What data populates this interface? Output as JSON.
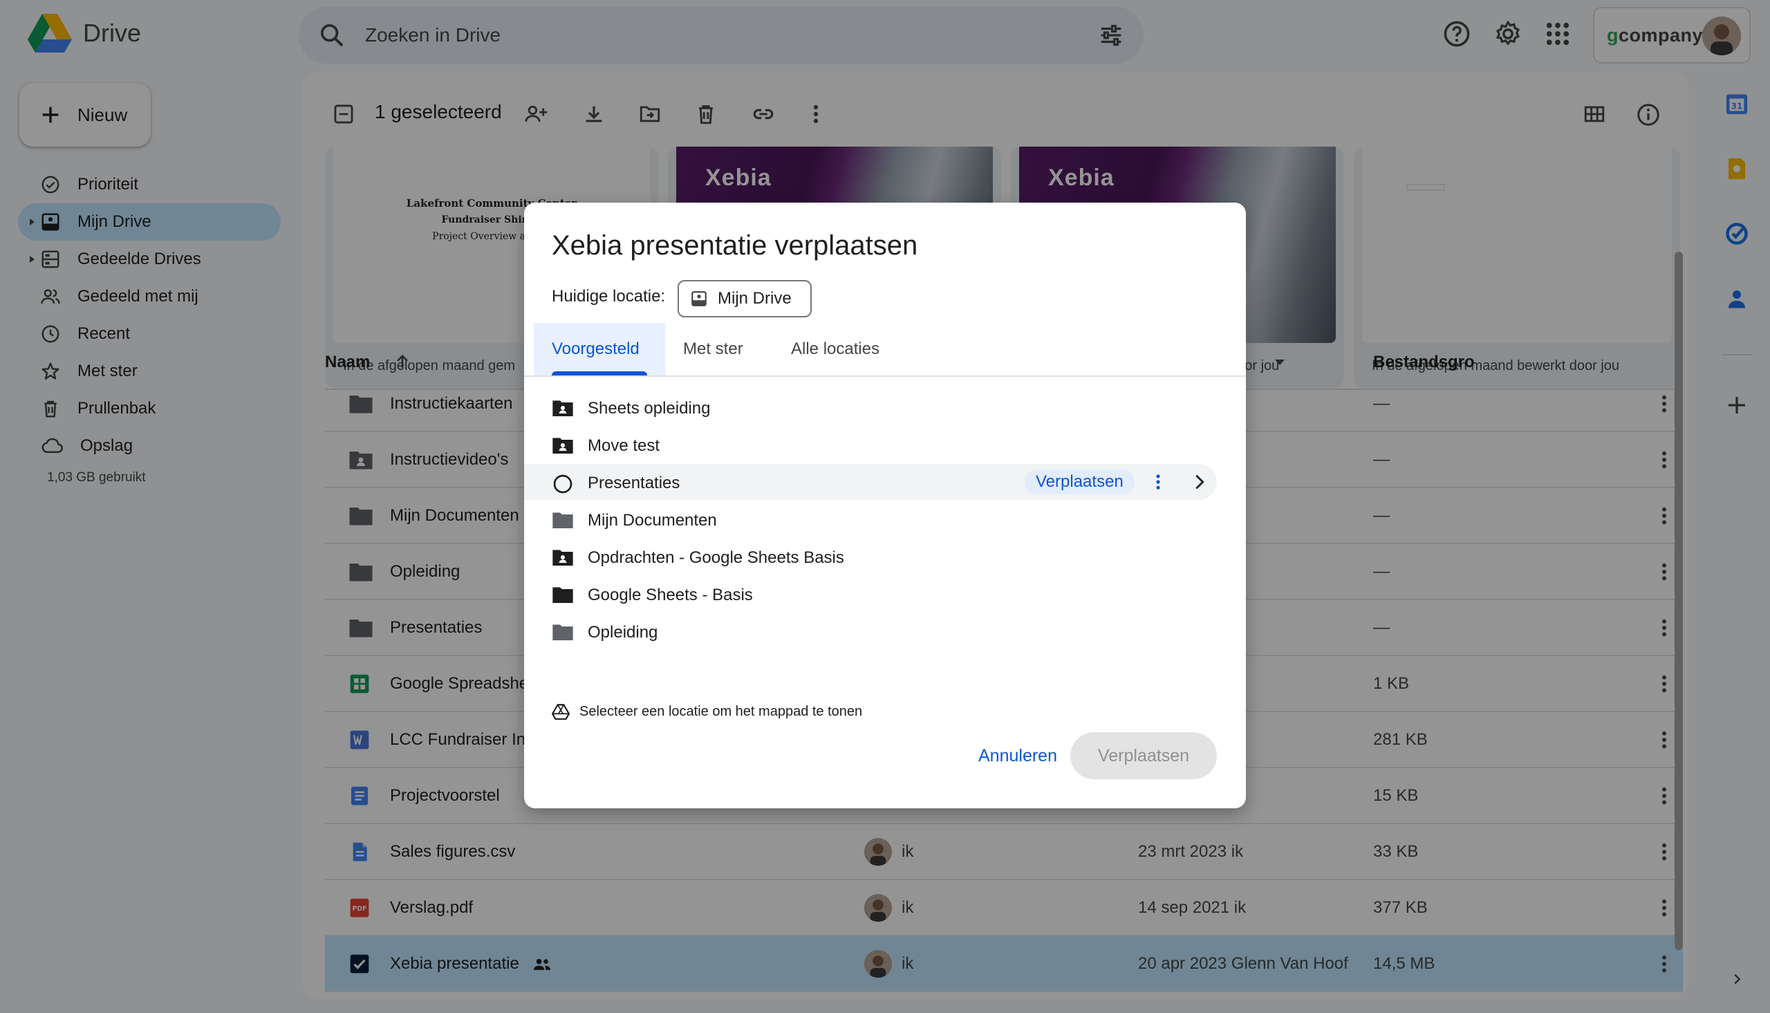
{
  "app": {
    "title": "Drive"
  },
  "search": {
    "placeholder": "Zoeken in Drive"
  },
  "account": {
    "brand_g": "g",
    "brand_rest": "company"
  },
  "sidebar": {
    "new_label": "Nieuw",
    "items": [
      {
        "label": "Prioriteit",
        "icon": "priority-icon"
      },
      {
        "label": "Mijn Drive",
        "icon": "my-drive-icon",
        "active": true
      },
      {
        "label": "Gedeelde Drives",
        "icon": "shared-drives-icon"
      },
      {
        "label": "Gedeeld met mij",
        "icon": "shared-with-me-icon"
      },
      {
        "label": "Recent",
        "icon": "clock-icon"
      },
      {
        "label": "Met ster",
        "icon": "star-icon"
      },
      {
        "label": "Prullenbak",
        "icon": "trash-icon"
      },
      {
        "label": "Opslag",
        "icon": "cloud-icon"
      }
    ],
    "storage_used": "1,03 GB gebruikt"
  },
  "toolbar": {
    "selected_count": "1 geselecteerd"
  },
  "cards": [
    {
      "caption": "In de afgelopen maand gem",
      "thumb_lines": [
        "Lakefront Community Center",
        "Fundraiser Shirt S",
        "Project Overview and M"
      ]
    },
    {
      "caption": "",
      "logo": "Xebia"
    },
    {
      "caption": "door jou",
      "logo": "Xebia"
    },
    {
      "caption": "In de afgelopen maand bewerkt door jou"
    }
  ],
  "table": {
    "headers": {
      "name": "Naam",
      "size": "Bestandsgro"
    },
    "rows": [
      {
        "name": "Instructiekaarten",
        "type": "folder",
        "owner": "",
        "date": "",
        "size": "—"
      },
      {
        "name": "Instructievideo's",
        "type": "shared-folder",
        "owner": "",
        "date": "",
        "size": "—"
      },
      {
        "name": "Mijn Documenten",
        "type": "folder",
        "owner": "",
        "date": "",
        "size": "—"
      },
      {
        "name": "Opleiding",
        "type": "folder",
        "owner": "",
        "date": "",
        "size": "—"
      },
      {
        "name": "Presentaties",
        "type": "folder",
        "owner": "",
        "date": "",
        "size": "—"
      },
      {
        "name": "Google Spreadshe",
        "type": "sheets",
        "owner": "",
        "date": "",
        "size": "1 KB"
      },
      {
        "name": "LCC Fundraiser In",
        "type": "word",
        "owner": "",
        "date": "",
        "size": "281 KB"
      },
      {
        "name": "Projectvoorstel",
        "type": "docs",
        "owner": "",
        "date": "",
        "size": "15 KB"
      },
      {
        "name": "Sales figures.csv",
        "type": "csv",
        "owner": "ik",
        "date": "23 mrt 2023",
        "date_by": "ik",
        "size": "33 KB"
      },
      {
        "name": "Verslag.pdf",
        "type": "pdf",
        "owner": "ik",
        "date": "14 sep 2021",
        "date_by": "ik",
        "size": "377 KB"
      },
      {
        "name": "Xebia presentatie",
        "type": "selected",
        "owner": "ik",
        "date": "20 apr 2023",
        "date_by": "Glenn Van Hoof",
        "size": "14,5 MB"
      }
    ]
  },
  "dialog": {
    "title": "Xebia presentatie verplaatsen",
    "current_location_label": "Huidige locatie:",
    "current_location": "Mijn Drive",
    "tabs": [
      "Voorgesteld",
      "Met ster",
      "Alle locaties"
    ],
    "folders": [
      {
        "name": "Sheets opleiding",
        "icon": "shared-folder-icon"
      },
      {
        "name": "Move test",
        "icon": "shared-folder-icon"
      },
      {
        "name": "Presentaties",
        "icon": "radio-icon",
        "hover": true
      },
      {
        "name": "Mijn Documenten",
        "icon": "folder-icon"
      },
      {
        "name": "Opdrachten - Google Sheets Basis",
        "icon": "shared-folder-icon"
      },
      {
        "name": "Google Sheets - Basis",
        "icon": "folder-black-icon"
      },
      {
        "name": "Opleiding",
        "icon": "folder-icon"
      }
    ],
    "row_move_label": "Verplaatsen",
    "hint": "Selecteer een locatie om het mappad te tonen",
    "cancel_label": "Annuleren",
    "move_label": "Verplaatsen"
  }
}
